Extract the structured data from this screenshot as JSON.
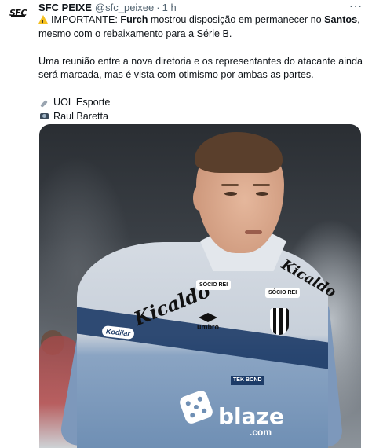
{
  "author": {
    "avatar_text": "SFC",
    "name": "SFC PEIXE",
    "handle": "@sfc_peixee",
    "separator": "·",
    "time": "1 h",
    "more": "···"
  },
  "tweet": {
    "line1_prefix": "IMPORTANTE:",
    "line1_name": "Furch",
    "line1_mid": "mostrou disposição em permanecer no",
    "line1_club": "Santos",
    "line1_end": ",",
    "line2": "mesmo com o rebaixamento para a Série B.",
    "para2_line1": "Uma reunião entre a nova diretoria e os representantes do atacante ainda",
    "para2_line2": "será marcada, mas é vista com otimismo por ambas as partes.",
    "credit1": "UOL Esporte",
    "credit2": "Raul Baretta"
  },
  "media": {
    "sponsor_main": "Kicaldo",
    "sponsor_side": "Kicaldo",
    "socio1": "SÓCIO REI",
    "socio2": "SÓCIO REI",
    "umbro": "umbro",
    "kodilar": "Kodilar",
    "tekbond": "TEK BOND",
    "blaze": "blaze",
    "blaze_sub": ".com"
  }
}
